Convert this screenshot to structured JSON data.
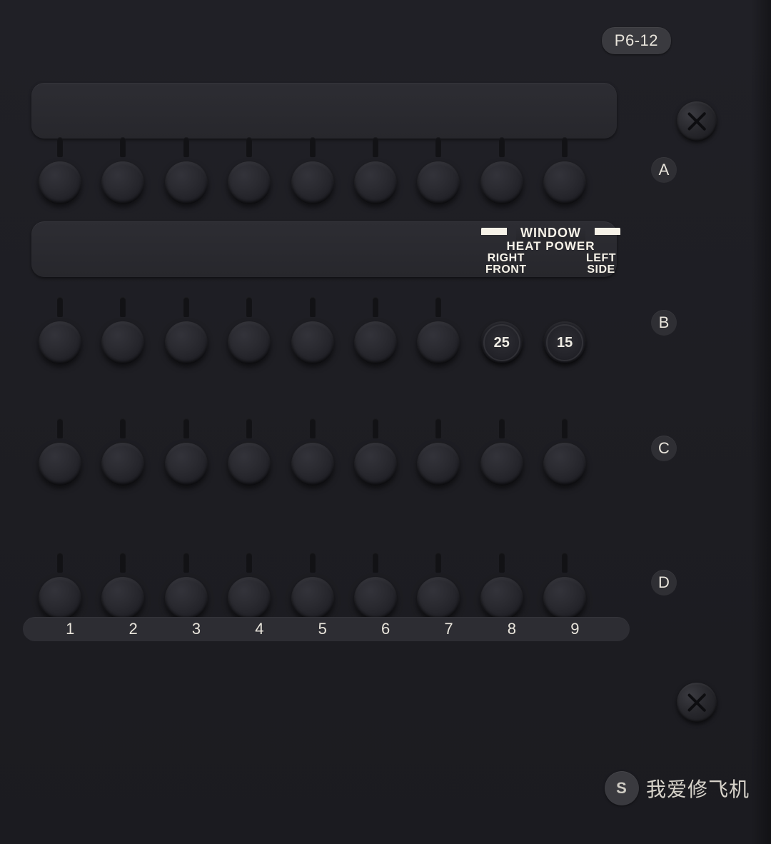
{
  "panel_id": "P6-12",
  "row_labels": [
    "A",
    "B",
    "C",
    "D"
  ],
  "col_numbers": [
    "1",
    "2",
    "3",
    "4",
    "5",
    "6",
    "7",
    "8",
    "9"
  ],
  "rows": {
    "A": {
      "has_bar": true,
      "slots": [
        {
          "type": "cap"
        },
        {
          "type": "cap"
        },
        {
          "type": "cap"
        },
        {
          "type": "cap"
        },
        {
          "type": "cap"
        },
        {
          "type": "cap"
        },
        {
          "type": "cap"
        },
        {
          "type": "cap"
        },
        {
          "type": "cap"
        }
      ]
    },
    "B": {
      "has_bar": true,
      "window_heat": {
        "group_label": "WINDOW",
        "sub_label": "HEAT POWER",
        "cols": [
          {
            "line1": "RIGHT",
            "line2": "FRONT"
          },
          {
            "line1": "LEFT",
            "line2": "SIDE"
          }
        ]
      },
      "slots": [
        {
          "type": "cap"
        },
        {
          "type": "cap"
        },
        {
          "type": "cap"
        },
        {
          "type": "cap"
        },
        {
          "type": "cap"
        },
        {
          "type": "cap"
        },
        {
          "type": "cap"
        },
        {
          "type": "fuse",
          "value": "25"
        },
        {
          "type": "fuse",
          "value": "15"
        }
      ]
    },
    "C": {
      "has_bar": false,
      "slots": [
        {
          "type": "cap"
        },
        {
          "type": "cap"
        },
        {
          "type": "cap"
        },
        {
          "type": "cap"
        },
        {
          "type": "cap"
        },
        {
          "type": "cap"
        },
        {
          "type": "cap"
        },
        {
          "type": "cap"
        },
        {
          "type": "cap"
        }
      ]
    },
    "D": {
      "has_bar": false,
      "slots": [
        {
          "type": "cap"
        },
        {
          "type": "cap"
        },
        {
          "type": "cap"
        },
        {
          "type": "cap"
        },
        {
          "type": "cap"
        },
        {
          "type": "cap"
        },
        {
          "type": "cap"
        },
        {
          "type": "cap"
        },
        {
          "type": "cap"
        }
      ]
    }
  },
  "watermark": {
    "icon": "S",
    "text": "我爱修飞机"
  }
}
